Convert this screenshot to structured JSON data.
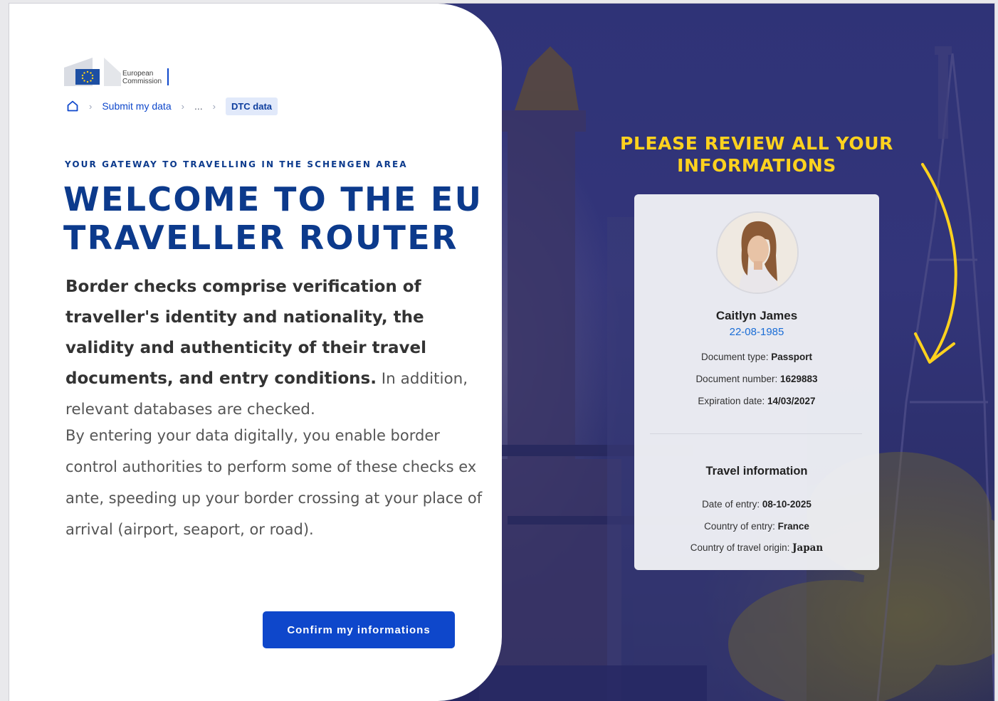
{
  "logo": {
    "line1": "European",
    "line2": "Commission"
  },
  "breadcrumb": {
    "home": "home",
    "item1": "Submit my data",
    "ellipsis": "...",
    "current": "DTC data"
  },
  "hero": {
    "tagline": "YOUR GATEWAY TO TRAVELLING IN THE SCHENGEN AREA",
    "title_line1": "WELCOME TO THE EU",
    "title_line2": "TRAVELLER ROUTER",
    "para1_bold": "Border checks comprise verification of traveller's identity and nationality, the validity and authenticity of their travel documents, and entry conditions.",
    "para1_rest": " In addition, relevant databases are checked.",
    "para2": "By entering your data digitally, you enable border control authorities to perform some of these checks ex ante, speeding up your border crossing at your place of arrival (airport, seaport, or road).",
    "confirm_label": "Confirm my informations"
  },
  "review": {
    "title_line1": "PLEASE REVIEW ALL YOUR",
    "title_line2": "INFORMATIONS"
  },
  "card": {
    "name": "Caitlyn James",
    "dob": "22-08-1985",
    "doc_type_label": "Document type: ",
    "doc_type": "Passport",
    "doc_number_label": "Document number: ",
    "doc_number": "1629883",
    "expiration_label": "Expiration date: ",
    "expiration": "14/03/2027",
    "travel_title": "Travel information",
    "entry_date_label": "Date of entry: ",
    "entry_date": "08-10-2025",
    "entry_country_label": "Country of entry: ",
    "entry_country": "France",
    "origin_label": "Country of travel origin: ",
    "origin": "Japan"
  },
  "colors": {
    "primary": "#0e47cb",
    "heading": "#0c3a8c",
    "accent_yellow": "#ffd21e",
    "background_dark": "#2f3377"
  }
}
